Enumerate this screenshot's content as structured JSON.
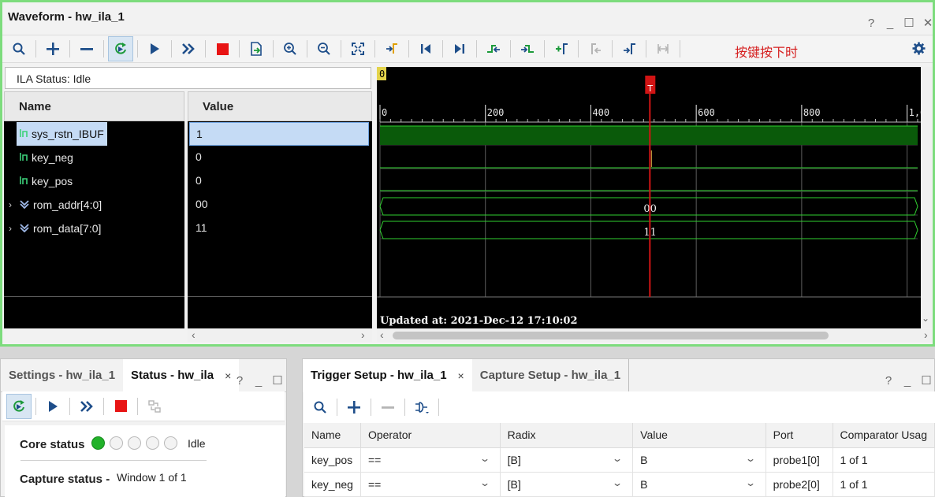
{
  "waveform": {
    "title": "Waveform - hw_ila_1",
    "window_controls": [
      "?",
      "_",
      "☐",
      "✕"
    ],
    "annotation": "按键按下时",
    "ila_status_label": "ILA Status:",
    "ila_status_value": "Idle",
    "name_header": "Name",
    "value_header": "Value",
    "signals": [
      {
        "name": "sys_rstn_IBUF",
        "value": "1",
        "kind": "bit",
        "selected": true
      },
      {
        "name": "key_neg",
        "value": "0",
        "kind": "bit",
        "selected": false
      },
      {
        "name": "key_pos",
        "value": "0",
        "kind": "bit",
        "selected": false
      },
      {
        "name": "rom_addr[4:0]",
        "value": "00",
        "kind": "bus",
        "selected": false
      },
      {
        "name": "rom_data[7:0]",
        "value": "11",
        "kind": "bus",
        "selected": false
      }
    ],
    "time_ruler": {
      "start_marker": "0",
      "ticks": [
        "0",
        "200",
        "400",
        "600",
        "800",
        "1,0"
      ],
      "trigger_marker": "T",
      "trigger_sample": 512,
      "range": [
        0,
        1024
      ]
    },
    "bus_wave_values": [
      "00",
      "11"
    ],
    "updated_text": "Updated at: 2021-Dec-12 17:10:02",
    "colors": {
      "signal_high": "#0a5a0a",
      "signal_line": "#2fd02f",
      "trigger": "#d11414",
      "grid": "#5d5d5d"
    }
  },
  "toolbar": {
    "icons": [
      "search-icon",
      "add-icon",
      "remove-icon",
      "auto-rearm-icon",
      "run-trigger-icon",
      "run-immediate-icon",
      "stop-icon",
      "export-icon",
      "zoom-in-icon",
      "zoom-out-icon",
      "zoom-fit-icon",
      "go-to-cursor-icon",
      "go-to-start-icon",
      "go-to-end-icon",
      "previous-transition-icon",
      "next-transition-icon",
      "add-marker-icon",
      "previous-marker-icon",
      "next-marker-icon",
      "swap-cursors-icon",
      "settings-icon"
    ]
  },
  "settings_panel": {
    "tabs": [
      {
        "label": "Settings - hw_ila_1",
        "active": false
      },
      {
        "label": "Status - hw_ila",
        "active": true,
        "close": "×"
      }
    ],
    "controls": [
      "?",
      "_",
      "☐"
    ],
    "core_status_label": "Core status",
    "core_status_value": "Idle",
    "capture_status_label": "Capture status -",
    "capture_status_value": "Window 1 of 1"
  },
  "trigger_panel": {
    "tabs": [
      {
        "label": "Trigger Setup - hw_ila_1",
        "active": true,
        "close": "×"
      },
      {
        "label": "Capture Setup - hw_ila_1",
        "active": false
      }
    ],
    "controls": [
      "?",
      "_",
      "☐"
    ],
    "columns": [
      "Name",
      "Operator",
      "Radix",
      "Value",
      "Port",
      "Comparator Usag"
    ],
    "rows": [
      {
        "name": "key_pos",
        "operator": "==",
        "radix": "[B]",
        "value": "B",
        "port": "probe1[0]",
        "comparator": "1 of 1"
      },
      {
        "name": "key_neg",
        "operator": "==",
        "radix": "[B]",
        "value": "B",
        "port": "probe2[0]",
        "comparator": "1 of 1"
      }
    ]
  }
}
